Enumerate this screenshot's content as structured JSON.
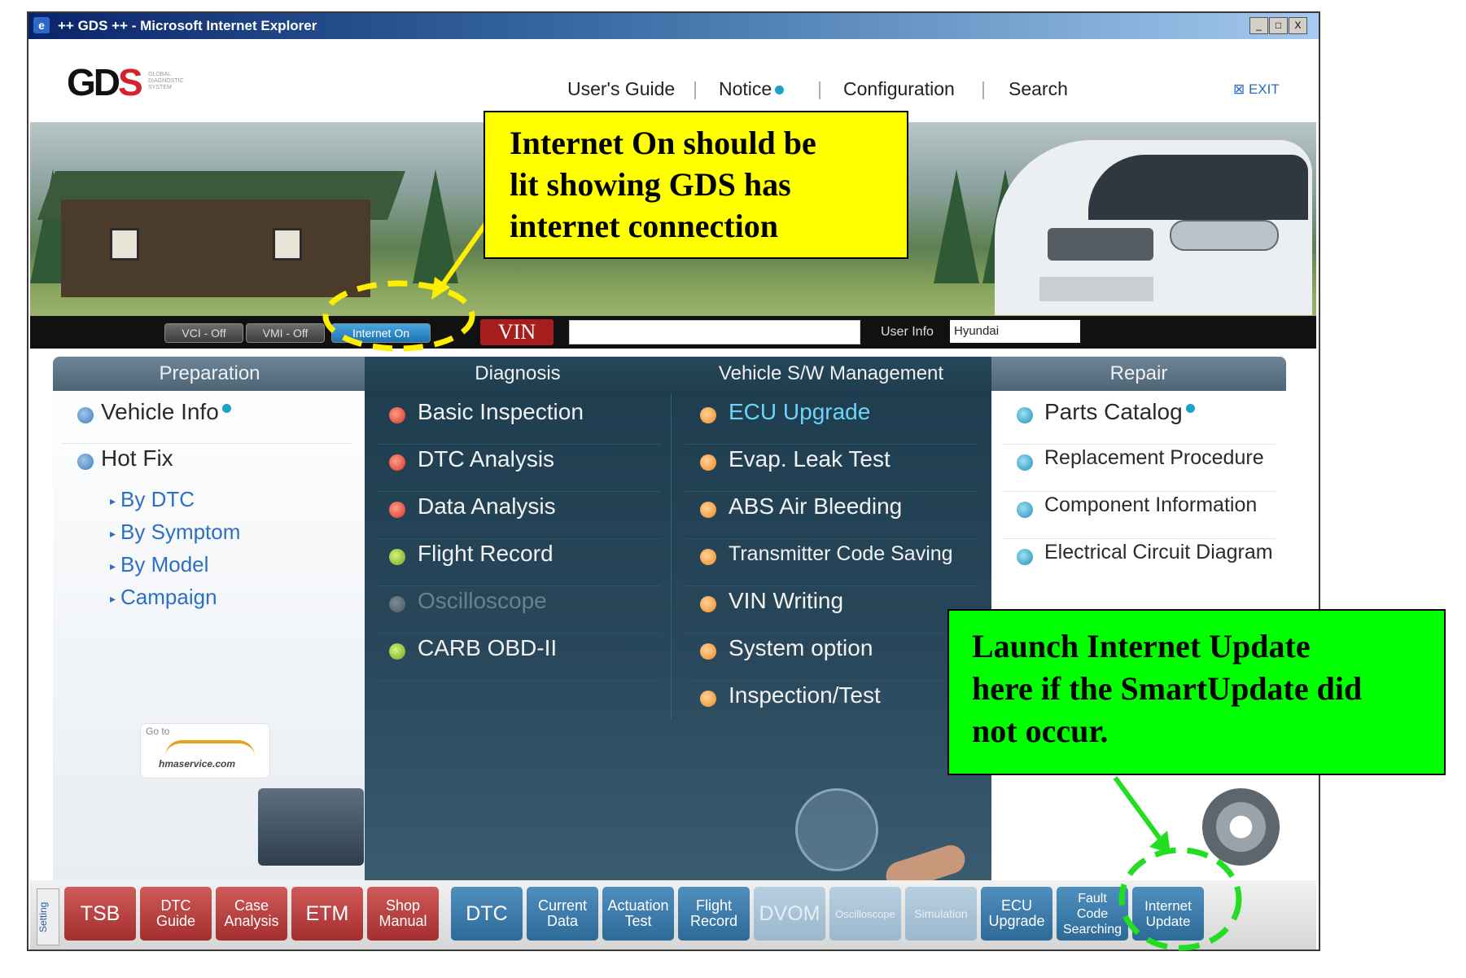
{
  "window": {
    "title": "++ GDS ++ - Microsoft Internet Explorer",
    "controls": [
      "_",
      "□",
      "X"
    ]
  },
  "header": {
    "logo": "GDS",
    "nav": [
      "User's Guide",
      "Notice",
      "Configuration",
      "Search"
    ],
    "exit_label": "EXIT"
  },
  "status_bar": {
    "indicators": [
      "VCI - Off",
      "VMI - Off",
      "Internet On"
    ],
    "vin_label": "VIN",
    "vin_value": "",
    "user_info_label": "User Info",
    "user_info_value": "Hyundai"
  },
  "menu": {
    "preparation": {
      "title": "Preparation",
      "items": [
        "Vehicle Info",
        "Hot Fix"
      ],
      "hotfix_subitems": [
        "By DTC",
        "By Symptom",
        "By Model",
        "Campaign"
      ],
      "promo_goto": "Go to",
      "promo_site": "hmaservice.com"
    },
    "diagnosis": {
      "title": "Diagnosis",
      "items": [
        "Basic Inspection",
        "DTC Analysis",
        "Data Analysis",
        "Flight Record",
        "Oscilloscope",
        "CARB OBD-II"
      ]
    },
    "vehicle_sw": {
      "title": "Vehicle S/W Management",
      "items": [
        "ECU Upgrade",
        "Evap. Leak Test",
        "ABS Air Bleeding",
        "Transmitter Code Saving",
        "VIN Writing",
        "System option",
        "Inspection/Test"
      ]
    },
    "repair": {
      "title": "Repair",
      "items": [
        "Parts Catalog",
        "Replacement Procedure",
        "Component Information",
        "Electrical Circuit Diagram"
      ]
    }
  },
  "toolbar": {
    "setting": "Setting",
    "buttons": [
      "TSB",
      "DTC Guide",
      "Case Analysis",
      "ETM",
      "Shop Manual",
      "DTC",
      "Current Data",
      "Actuation Test",
      "Flight Record",
      "DVOM",
      "Oscilloscope",
      "Simulation",
      "ECU Upgrade",
      "Fault Code Searching",
      "Internet Update"
    ]
  },
  "annotations": {
    "callout_internet": "Internet On should be lit showing GDS has internet connection",
    "callout_internet_lines": [
      "Internet On should be",
      "lit showing GDS has",
      "internet connection"
    ],
    "callout_update_lines": [
      "Launch Internet Update",
      "here if the SmartUpdate did",
      "not occur."
    ]
  },
  "colors": {
    "callout_yellow": "#ffff00",
    "callout_green": "#00ff00",
    "highlight_yellow_dash": "#ffee00",
    "highlight_green_dash": "#22dd22",
    "menu_dark": "#1d3d4f",
    "toolbar_red": "#a52e2e",
    "toolbar_blue": "#2d6a98"
  }
}
